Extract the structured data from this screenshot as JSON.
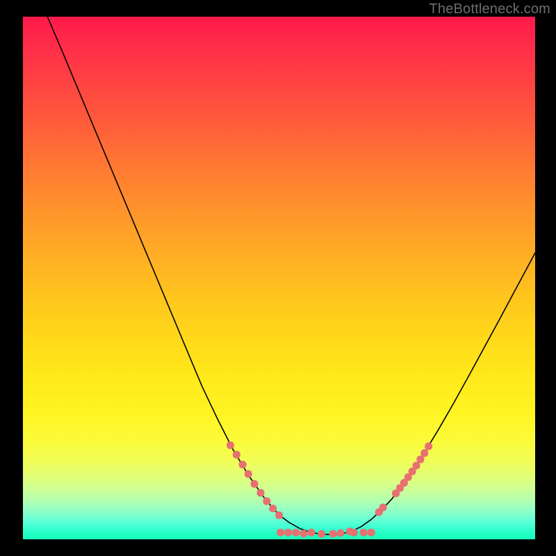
{
  "watermark": "TheBottleneck.com",
  "chart_data": {
    "type": "line",
    "title": "",
    "xlabel": "",
    "ylabel": "",
    "xlim": [
      0,
      100
    ],
    "ylim": [
      0,
      100
    ],
    "grid": false,
    "legend": false,
    "series": [
      {
        "name": "bottleneck-curve",
        "color": "#000000",
        "points": [
          {
            "x": 4.8,
            "y": 100.0
          },
          {
            "x": 8.0,
            "y": 92.6
          },
          {
            "x": 12.0,
            "y": 83.2
          },
          {
            "x": 16.0,
            "y": 73.8
          },
          {
            "x": 20.0,
            "y": 64.4
          },
          {
            "x": 24.0,
            "y": 55.0
          },
          {
            "x": 28.0,
            "y": 45.6
          },
          {
            "x": 32.0,
            "y": 36.2
          },
          {
            "x": 35.0,
            "y": 29.2
          },
          {
            "x": 38.0,
            "y": 23.0
          },
          {
            "x": 41.0,
            "y": 17.2
          },
          {
            "x": 44.0,
            "y": 12.3
          },
          {
            "x": 47.0,
            "y": 8.1
          },
          {
            "x": 49.0,
            "y": 5.7
          },
          {
            "x": 50.5,
            "y": 4.3
          },
          {
            "x": 52.0,
            "y": 3.2
          },
          {
            "x": 54.0,
            "y": 2.1
          },
          {
            "x": 56.0,
            "y": 1.4
          },
          {
            "x": 58.0,
            "y": 1.0
          },
          {
            "x": 60.0,
            "y": 0.9
          },
          {
            "x": 62.0,
            "y": 1.0
          },
          {
            "x": 64.0,
            "y": 1.5
          },
          {
            "x": 66.0,
            "y": 2.4
          },
          {
            "x": 68.0,
            "y": 3.8
          },
          {
            "x": 70.0,
            "y": 5.6
          },
          {
            "x": 72.0,
            "y": 7.7
          },
          {
            "x": 74.0,
            "y": 10.2
          },
          {
            "x": 76.0,
            "y": 13.0
          },
          {
            "x": 78.0,
            "y": 16.0
          },
          {
            "x": 81.0,
            "y": 20.8
          },
          {
            "x": 84.0,
            "y": 25.9
          },
          {
            "x": 87.0,
            "y": 31.2
          },
          {
            "x": 90.0,
            "y": 36.6
          },
          {
            "x": 93.0,
            "y": 42.0
          },
          {
            "x": 96.0,
            "y": 47.5
          },
          {
            "x": 100.0,
            "y": 54.8
          }
        ]
      }
    ],
    "markers": [
      {
        "name": "highlight-dots",
        "color": "#e77070",
        "points": [
          {
            "x": 40.5,
            "y": 18.0
          },
          {
            "x": 41.7,
            "y": 16.2
          },
          {
            "x": 42.9,
            "y": 14.3
          },
          {
            "x": 44.0,
            "y": 12.5
          },
          {
            "x": 45.2,
            "y": 10.6
          },
          {
            "x": 46.4,
            "y": 8.9
          },
          {
            "x": 47.6,
            "y": 7.3
          },
          {
            "x": 48.8,
            "y": 5.9
          },
          {
            "x": 50.0,
            "y": 4.6
          },
          {
            "x": 50.3,
            "y": 1.3
          },
          {
            "x": 51.8,
            "y": 1.3
          },
          {
            "x": 53.3,
            "y": 1.3
          },
          {
            "x": 54.8,
            "y": 1.1
          },
          {
            "x": 56.3,
            "y": 1.3
          },
          {
            "x": 58.3,
            "y": 1.05
          },
          {
            "x": 60.5,
            "y": 1.05
          },
          {
            "x": 62.0,
            "y": 1.2
          },
          {
            "x": 63.8,
            "y": 1.5
          },
          {
            "x": 64.6,
            "y": 1.3
          },
          {
            "x": 66.5,
            "y": 1.3
          },
          {
            "x": 68.0,
            "y": 1.3
          },
          {
            "x": 69.5,
            "y": 5.2
          },
          {
            "x": 70.3,
            "y": 6.1
          },
          {
            "x": 72.8,
            "y": 8.8
          },
          {
            "x": 73.6,
            "y": 9.8
          },
          {
            "x": 74.4,
            "y": 10.8
          },
          {
            "x": 75.2,
            "y": 11.9
          },
          {
            "x": 76.0,
            "y": 13.0
          },
          {
            "x": 76.8,
            "y": 14.1
          },
          {
            "x": 77.6,
            "y": 15.3
          },
          {
            "x": 78.4,
            "y": 16.5
          },
          {
            "x": 79.2,
            "y": 17.8
          }
        ]
      }
    ]
  }
}
